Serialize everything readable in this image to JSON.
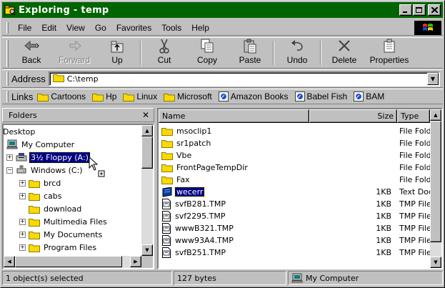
{
  "window": {
    "title": "Exploring - temp"
  },
  "menu": [
    "File",
    "Edit",
    "View",
    "Go",
    "Favorites",
    "Tools",
    "Help"
  ],
  "toolbar": {
    "back": "Back",
    "forward": "Forward",
    "up": "Up",
    "cut": "Cut",
    "copy": "Copy",
    "paste": "Paste",
    "undo": "Undo",
    "delete": "Delete",
    "properties": "Properties"
  },
  "address": {
    "label": "Address",
    "value": "C:\\temp"
  },
  "links": {
    "label": "Links",
    "items": [
      {
        "label": "Cartoons",
        "icon": "folder-icon"
      },
      {
        "label": "Hp",
        "icon": "folder-icon"
      },
      {
        "label": "Linux",
        "icon": "folder-icon"
      },
      {
        "label": "Microsoft",
        "icon": "folder-icon"
      },
      {
        "label": "Amazon Books",
        "icon": "web-link-icon"
      },
      {
        "label": "Babel Fish",
        "icon": "web-link-icon"
      },
      {
        "label": "BAM",
        "icon": "web-link-icon"
      }
    ]
  },
  "folders_pane": {
    "header": "Folders",
    "close": "✕",
    "tree": [
      {
        "label": "Desktop",
        "icon": "desktop-icon",
        "level": 0
      },
      {
        "label": "My Computer",
        "icon": "computer-icon",
        "level": 1
      },
      {
        "label": "3½ Floppy (A:)",
        "icon": "floppy-drive-icon",
        "level": 1,
        "selected": true,
        "expander": "+"
      },
      {
        "label": "Windows (C:)",
        "icon": "hard-drive-icon",
        "level": 1,
        "expander": "−"
      },
      {
        "label": "brcd",
        "icon": "folder-icon",
        "level": 2,
        "expander": "+"
      },
      {
        "label": "cabs",
        "icon": "folder-icon",
        "level": 2,
        "expander": "+"
      },
      {
        "label": "download",
        "icon": "folder-icon",
        "level": 2
      },
      {
        "label": "Multimedia Files",
        "icon": "folder-icon",
        "level": 2,
        "expander": "+"
      },
      {
        "label": "My Documents",
        "icon": "folder-icon",
        "level": 2,
        "expander": "+"
      },
      {
        "label": "Program Files",
        "icon": "folder-icon",
        "level": 2,
        "expander": "+"
      }
    ]
  },
  "files_pane": {
    "columns": {
      "name": "Name",
      "size": "Size",
      "type": "Type"
    },
    "rows": [
      {
        "name": "msoclip1",
        "size": "",
        "type": "File Folder",
        "icon": "folder-icon"
      },
      {
        "name": "sr1patch",
        "size": "",
        "type": "File Folder",
        "icon": "folder-icon"
      },
      {
        "name": "Vbe",
        "size": "",
        "type": "File Folder",
        "icon": "folder-icon"
      },
      {
        "name": "FrontPageTempDir",
        "size": "",
        "type": "File Folder",
        "icon": "folder-icon"
      },
      {
        "name": "Fax",
        "size": "",
        "type": "File Folder",
        "icon": "folder-icon"
      },
      {
        "name": "wecerr",
        "size": "1KB",
        "type": "Text Document",
        "icon": "text-document-icon",
        "selected": true
      },
      {
        "name": "svfB281.TMP",
        "size": "1KB",
        "type": "TMP File",
        "icon": "tmp-file-icon"
      },
      {
        "name": "svf2295.TMP",
        "size": "1KB",
        "type": "TMP File",
        "icon": "tmp-file-icon"
      },
      {
        "name": "wwwB321.TMP",
        "size": "1KB",
        "type": "TMP File",
        "icon": "tmp-file-icon"
      },
      {
        "name": "www93A4.TMP",
        "size": "1KB",
        "type": "TMP File",
        "icon": "tmp-file-icon"
      },
      {
        "name": "svfB251.TMP",
        "size": "1KB",
        "type": "TMP File",
        "icon": "tmp-file-icon"
      }
    ]
  },
  "status": {
    "selection": "1 object(s) selected",
    "size": "127 bytes",
    "location": "My Computer"
  }
}
